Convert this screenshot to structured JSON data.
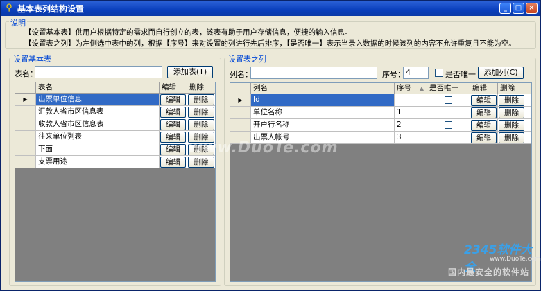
{
  "window": {
    "title": "基本表列结构设置",
    "min_label": "_",
    "max_label": "□",
    "close_label": "×"
  },
  "description": {
    "group_title": "说明",
    "line1": "【设置基本表】供用户根据特定的需求而自行创立的表，该表有助于用户存储信息，便捷的输入信息。",
    "line2": "【设置表之列】为左侧选中表中的列，根据【序号】来对设置的列进行先后排序，【是否唯一】表示当录入数据的时候该列的内容不允许重复且不能为空。"
  },
  "left_panel": {
    "group_title": "设置基本表",
    "name_label": "表名：",
    "name_value": "",
    "add_button": "添加表(T)",
    "columns": [
      "表名",
      "编辑",
      "删除"
    ],
    "edit_label": "编辑",
    "delete_label": "删除",
    "rows": [
      {
        "name": "出票单位信息",
        "selected": true
      },
      {
        "name": "汇款人省市区信息表",
        "selected": false
      },
      {
        "name": "收款人省市区信息表",
        "selected": false
      },
      {
        "name": "往来单位列表",
        "selected": false
      },
      {
        "name": "下面",
        "selected": false
      },
      {
        "name": "支票用途",
        "selected": false
      }
    ]
  },
  "right_panel": {
    "group_title": "设置表之列",
    "name_label": "列名：",
    "name_value": "",
    "seq_label": "序号：",
    "seq_value": "4",
    "unique_label": "是否唯一",
    "add_button": "添加列(C)",
    "columns": [
      "列名",
      "序号",
      "是否唯一",
      "编辑",
      "删除"
    ],
    "edit_label": "编辑",
    "delete_label": "删除",
    "rows": [
      {
        "name": "Id",
        "seq": "",
        "selected": true
      },
      {
        "name": "单位名称",
        "seq": "1",
        "selected": false
      },
      {
        "name": "开户行名称",
        "seq": "2",
        "selected": false
      },
      {
        "name": "出票人帐号",
        "seq": "3",
        "selected": false
      }
    ]
  },
  "watermarks": {
    "center": "www.DuoTe.com",
    "brand": "2345软件大全",
    "url": "www.DuoTe.com",
    "tag": "国内最安全的软件站"
  }
}
